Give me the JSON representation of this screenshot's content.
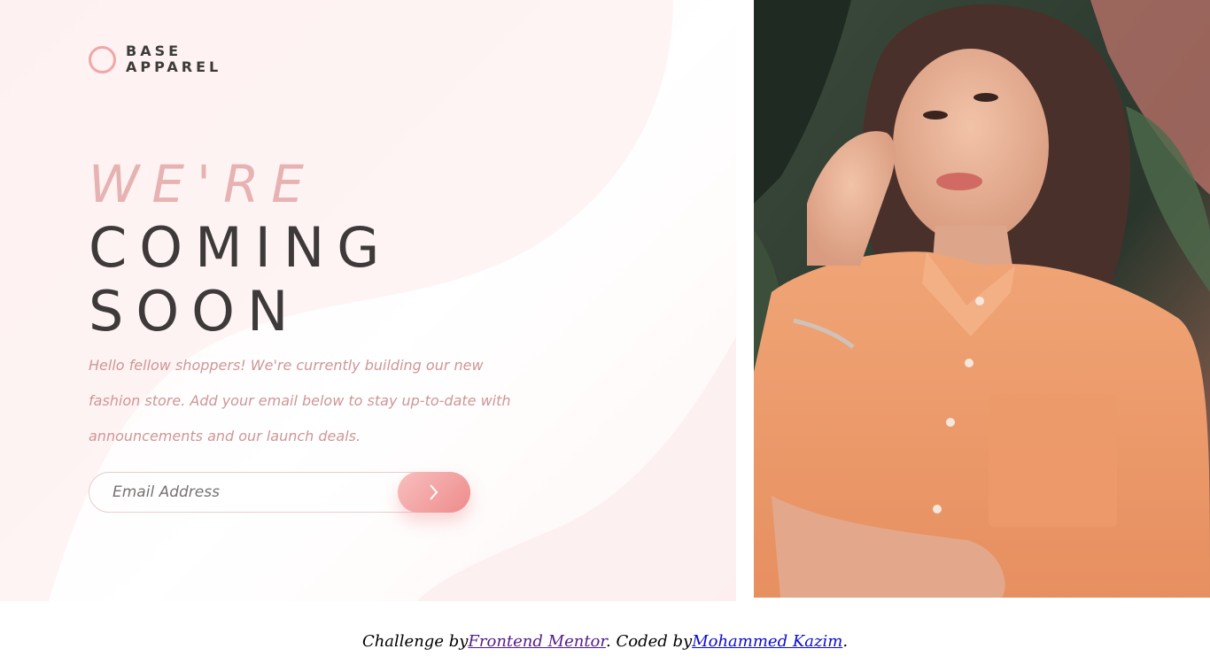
{
  "brand": {
    "line1": "BASE",
    "line2": "APPAREL",
    "accent_color": "#f1a7a7"
  },
  "headline": {
    "light": "WE'RE",
    "dark_line1": "COMING",
    "dark_line2": "SOON"
  },
  "intro": {
    "text": "Hello fellow shoppers! We're currently building our new fashion store. Add your email below to stay up-to-date with announcements and our launch deals."
  },
  "form": {
    "email_placeholder": "Email Address",
    "submit_icon": "chevron-right-icon"
  },
  "hero": {
    "image": "woman-in-orange-shirt-photo"
  },
  "footer": {
    "prefix": "Challenge by",
    "link1": "Frontend Mentor",
    "middle": ". Coded by",
    "link2": "Mohammed Kazim",
    "suffix": "."
  },
  "colors": {
    "text_dark": "#3f3a3a",
    "text_pink": "#cf9696",
    "button_gradient_start": "#f8bfbf",
    "button_gradient_end": "#ee8b8b"
  }
}
